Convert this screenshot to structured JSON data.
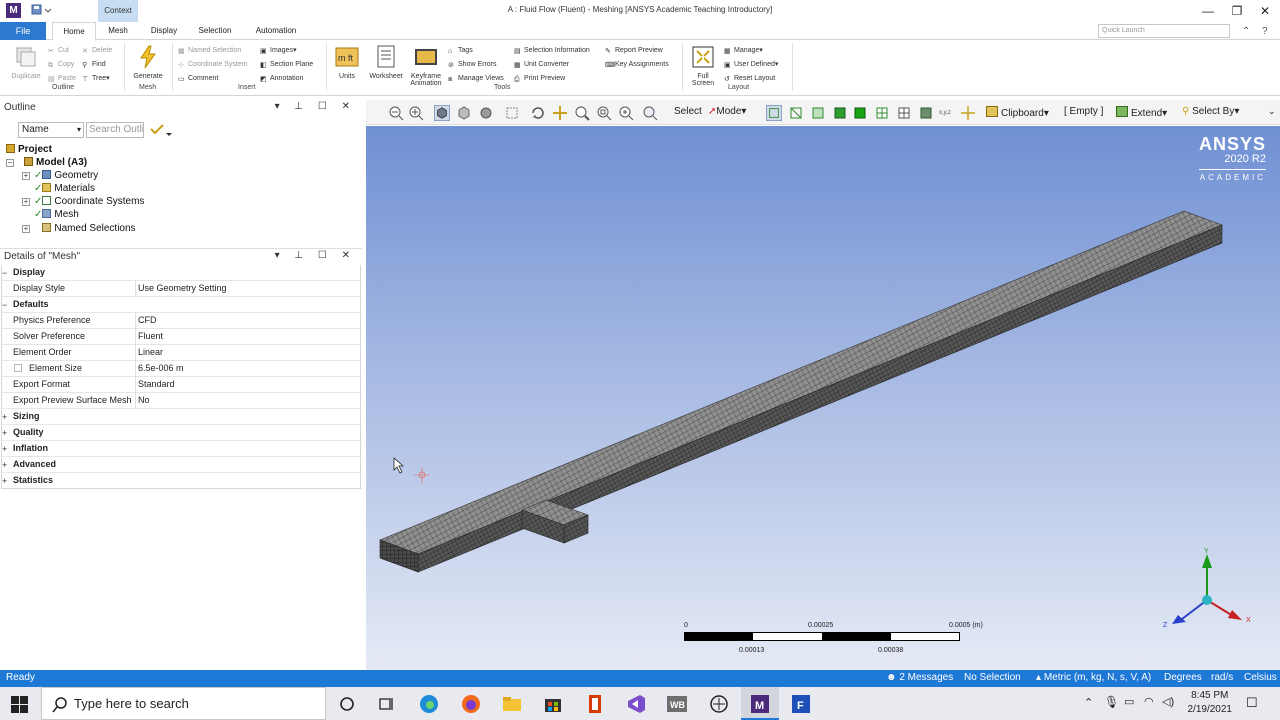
{
  "titlebar": {
    "app_letter": "M",
    "context_tab": "Context",
    "window_title": "A : Fluid Flow (Fluent) - Meshing [ANSYS Academic Teaching Introductory]",
    "minimize": "—",
    "restore": "❐",
    "close": "✕"
  },
  "ribbon_tabs": [
    "File",
    "Home",
    "Mesh",
    "Display",
    "Selection",
    "Automation"
  ],
  "quick_launch_placeholder": "Quick Launch",
  "ribbon": {
    "outline_group": {
      "duplicate": "Duplicate",
      "cut": "Cut",
      "copy": "Copy",
      "paste": "Paste",
      "delete": "Delete",
      "find": "Find",
      "tree": "Tree",
      "label": "Outline"
    },
    "mesh_group": {
      "generate": "Generate",
      "label": "Mesh"
    },
    "insert_group": {
      "named_selection": "Named Selection",
      "coordinate_system": "Coordinate System",
      "comment": "Comment",
      "images": "Images",
      "section_plane": "Section Plane",
      "annotation": "Annotation",
      "label": "Insert"
    },
    "tools_group": {
      "units": "Units",
      "worksheet": "Worksheet",
      "keyframe": "Keyframe",
      "animation": "Animation",
      "tags": "Tags",
      "show_errors": "Show Errors",
      "manage_views": "Manage Views",
      "selection_information": "Selection Information",
      "unit_converter": "Unit Converter",
      "print_preview": "Print Preview",
      "report_preview": "Report Preview",
      "key_assignments": "Key Assignments",
      "label": "Tools"
    },
    "layout_group": {
      "full": "Full",
      "screen": "Screen",
      "manage": "Manage",
      "user_defined": "User Defined",
      "reset_layout": "Reset Layout",
      "label": "Layout"
    }
  },
  "outline": {
    "title": "Outline",
    "filter_value": "Name",
    "search_placeholder": "Search Outline",
    "tree": [
      "Project",
      "Model (A3)",
      "Geometry",
      "Materials",
      "Coordinate Systems",
      "Mesh",
      "Named Selections"
    ]
  },
  "details": {
    "title": "Details of \"Mesh\"",
    "rows": [
      {
        "type": "section",
        "key": "Display",
        "sign": "−"
      },
      {
        "type": "row",
        "key": "Display Style",
        "value": "Use Geometry Setting"
      },
      {
        "type": "section",
        "key": "Defaults",
        "sign": "−"
      },
      {
        "type": "row",
        "key": "Physics Preference",
        "value": "CFD"
      },
      {
        "type": "row",
        "key": "Solver Preference",
        "value": "Fluent"
      },
      {
        "type": "row",
        "key": "Element Order",
        "value": "Linear"
      },
      {
        "type": "row",
        "key": "Element Size",
        "value": "6.5e-006 m"
      },
      {
        "type": "row",
        "key": "Export Format",
        "value": "Standard"
      },
      {
        "type": "row",
        "key": "Export Preview Surface Mesh",
        "value": "No"
      },
      {
        "type": "section",
        "key": "Sizing",
        "sign": "+"
      },
      {
        "type": "section",
        "key": "Quality",
        "sign": "+"
      },
      {
        "type": "section",
        "key": "Inflation",
        "sign": "+"
      },
      {
        "type": "section",
        "key": "Advanced",
        "sign": "+"
      },
      {
        "type": "section",
        "key": "Statistics",
        "sign": "+"
      }
    ]
  },
  "viewport_toolbar": {
    "select": "Select",
    "mode": "Mode",
    "clipboard": "Clipboard",
    "empty": "[ Empty ]",
    "extend": "Extend",
    "select_by": "Select By"
  },
  "viewport": {
    "logo_brand": "ANSYS",
    "logo_version": "2020 R2",
    "logo_edition": "ACADEMIC",
    "scale": {
      "top_labels": [
        "0",
        "0.00025",
        "0.0005 (m)"
      ],
      "bottom_labels": [
        "0.00013",
        "0.00038"
      ]
    },
    "triad": {
      "x": "X",
      "y": "Y",
      "z": "Z"
    }
  },
  "statusbar": {
    "ready": "Ready",
    "messages": "2 Messages",
    "selection": "No Selection",
    "units": "Metric (m, kg, N, s, V, A)",
    "angle": "Degrees",
    "rate": "rad/s",
    "temp": "Celsius"
  },
  "taskbar": {
    "search_placeholder": "Type here to search",
    "time": "8:45 PM",
    "date": "2/19/2021"
  },
  "colors": {
    "accent": "#1e78d6",
    "file_tab": "#2b79d0",
    "mesh_dark": "#3d3d3d",
    "viewport_top": "#6f90d3"
  }
}
